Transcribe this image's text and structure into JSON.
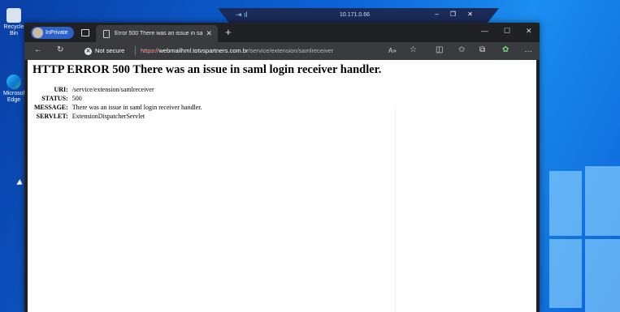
{
  "remote_bar": {
    "ip": "10.171.0.66"
  },
  "desktop": {
    "icons": [
      {
        "label": "Recycle Bin"
      },
      {
        "label": "Microsoft Edge"
      }
    ]
  },
  "browser": {
    "inprivate_label": "InPrivate",
    "tab_title": "Error 500 There was an issue in sa",
    "security_label": "Not secure",
    "url_protocol": "https://",
    "url_host": "webmailhml.totvspartners.com.br",
    "url_path": "/service/extension/samlreceiver"
  },
  "page": {
    "heading": "HTTP ERROR 500 There was an issue in saml login receiver handler.",
    "rows": [
      {
        "label": "URI:",
        "value": "/service/extension/samlreceiver"
      },
      {
        "label": "STATUS:",
        "value": "500"
      },
      {
        "label": "MESSAGE:",
        "value": "There was an issue in saml login receiver handler."
      },
      {
        "label": "SERVLET:",
        "value": "ExtensionDispatcherServlet"
      }
    ]
  }
}
